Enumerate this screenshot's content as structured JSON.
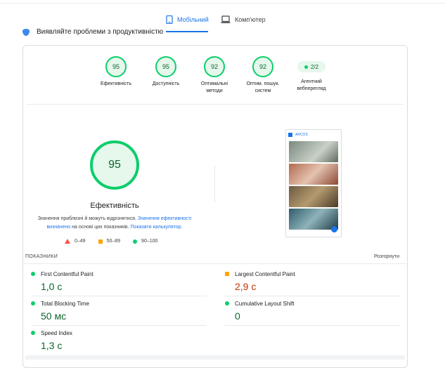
{
  "tabs": {
    "mobile_label": "Мобільний",
    "desktop_label": "Комп'ютер"
  },
  "diagnose_title": "Виявляйте проблеми з продуктивністю",
  "gauges": [
    {
      "score": "95",
      "label": "Ефективність"
    },
    {
      "score": "95",
      "label": "Доступність"
    },
    {
      "score": "92",
      "label_line1": "Оптимальні",
      "label_line2": "методи"
    },
    {
      "score": "92",
      "label_line1": "Оптим. пошук.",
      "label_line2": "систем"
    },
    {
      "score": "2/2",
      "label_line1": "Агентний",
      "label_line2": "вебперегляд"
    }
  ],
  "performance": {
    "score": "95",
    "title": "Ефективність",
    "note_prefix": "Значення приблизні й можуть відрізнятися. ",
    "note_link1": "Значення ефективності визначено",
    "note_mid": " на основі цих показників. ",
    "note_link2": "Показати калькулятор."
  },
  "legend": {
    "fail": "0–49",
    "average": "50–89",
    "pass": "90–100"
  },
  "screenshot": {
    "logo_text": "ARCOS"
  },
  "metrics": {
    "header": "ПОКАЗНИКИ",
    "expand": "Розгорнути",
    "items": [
      {
        "name": "First Contentful Paint",
        "value": "1,0 с",
        "status": "good"
      },
      {
        "name": "Largest Contentful Paint",
        "value": "2,9 с",
        "status": "average"
      },
      {
        "name": "Total Blocking Time",
        "value": "50 мс",
        "status": "good"
      },
      {
        "name": "Cumulative Layout Shift",
        "value": "0",
        "status": "good"
      },
      {
        "name": "Speed Index",
        "value": "1,3 с",
        "status": "good"
      }
    ]
  },
  "colors": {
    "accent": "#1a73e8",
    "pass": "#0cce6b",
    "average": "#ffa400",
    "fail": "#ff4e42"
  }
}
